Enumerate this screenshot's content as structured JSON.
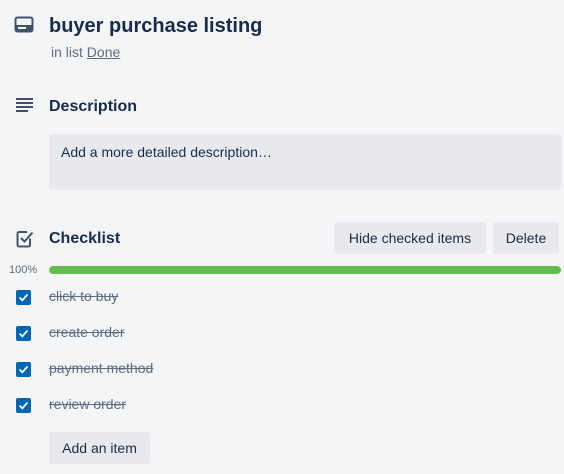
{
  "card": {
    "title": "buyer purchase listing",
    "in_list_prefix": "in list",
    "list_name": "Done",
    "icon": "card-icon"
  },
  "description": {
    "title": "Description",
    "placeholder": "Add a more detailed description…",
    "icon": "description-lines-icon"
  },
  "checklist": {
    "title": "Checklist",
    "icon": "checklist-checkbox-icon",
    "hide_checked_label": "Hide checked items",
    "delete_label": "Delete",
    "progress_label": "100%",
    "progress": 1.0,
    "items": [
      {
        "label": "click to buy",
        "checked": true
      },
      {
        "label": "create order",
        "checked": true
      },
      {
        "label": "payment method",
        "checked": true
      },
      {
        "label": "review order",
        "checked": true
      }
    ],
    "add_item_label": "Add an item"
  },
  "colors": {
    "background": "#f4f5f7",
    "progress_fill": "#61bd4f",
    "checkbox_checked": "#0065b5",
    "button_bg": "#e8e9ed"
  }
}
